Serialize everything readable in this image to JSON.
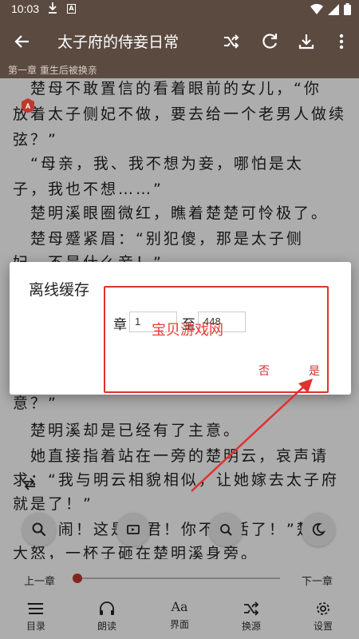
{
  "status_bar": {
    "time": "10:03"
  },
  "app_bar": {
    "title": "太子府的侍妾日常"
  },
  "chapter_strip": "第一章 重生后被换亲",
  "reader": {
    "lines": [
      "　楚母不敢置信的看着眼前的女儿，“你",
      "放着太子侧妃不做，要去给一个老男人做续",
      "弦？”",
      "　“母亲，我、我不想为妾，哪怕是太",
      "子，我也不想……”",
      "　楚明溪眼圈微红，瞧着楚楚可怜极了。",
      "　楚母蹙紧眉：“别犯傻，那是太子侧",
      "妃，不是什么妾！”",
      "意？”",
      "　楚明溪却是已经有了主意。",
      "　她直接指着站在一旁的楚明云，哀声请",
      "求：“我与明云相貌相似，让她嫁去太子府",
      "就是了！”",
      "　“胡闹！这是欺君！你不想活了！”楚父",
      "大怒，一杯子砸在楚明溪身旁。"
    ]
  },
  "dialog": {
    "title": "离线缓存",
    "chapter_label": "章",
    "from_value": "1",
    "to_label": "至",
    "to_value": "448",
    "no_label": "否",
    "yes_label": "是",
    "watermark": "宝贝游戏网"
  },
  "progress": {
    "prev_label": "上一章",
    "next_label": "下一章",
    "fraction": 0.0
  },
  "bottom_nav": {
    "items": [
      {
        "label": "目录",
        "icon": "list-icon"
      },
      {
        "label": "朗读",
        "icon": "headphones-icon"
      },
      {
        "label": "界面",
        "icon": "text-format-icon",
        "glyph": "Aa"
      },
      {
        "label": "换源",
        "icon": "shuffle-icon"
      },
      {
        "label": "设置",
        "icon": "gear-icon"
      }
    ]
  },
  "colors": {
    "toolbar": "#5a4a40",
    "accent": "#c0392b",
    "annotation": "#e0312e"
  }
}
